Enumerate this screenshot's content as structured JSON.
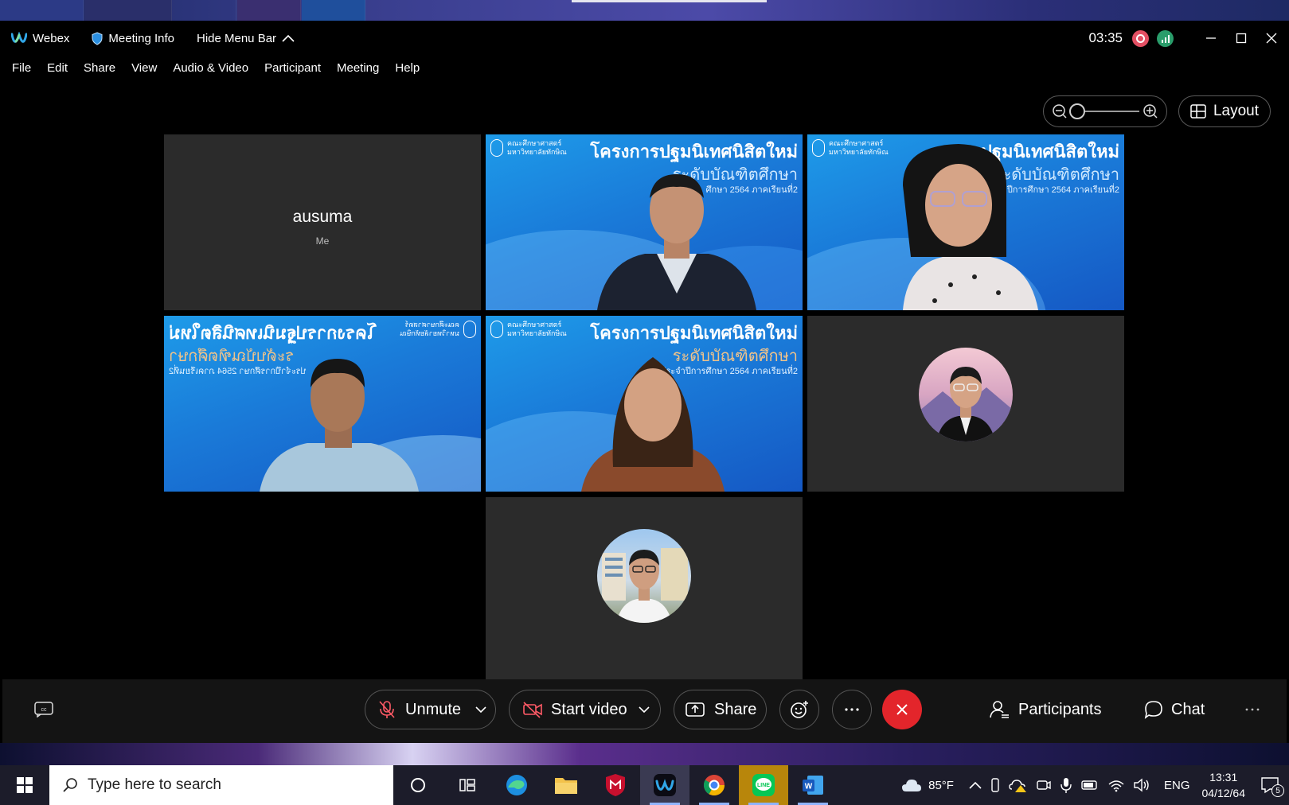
{
  "window": {
    "app_name": "Webex",
    "meeting_info_label": "Meeting Info",
    "hide_menu_label": "Hide Menu Bar",
    "elapsed_time": "03:35"
  },
  "menu": [
    "File",
    "Edit",
    "Share",
    "View",
    "Audio & Video",
    "Participant",
    "Meeting",
    "Help"
  ],
  "layout_label": "Layout",
  "tiles": {
    "self_name": "ausuma",
    "self_tag": "Me",
    "banner_title": "โครงการปฐมนิเทศนิสิตใหม่",
    "banner_sub": "ระดับบัณฑิตศึกษา",
    "banner_sub2": "ประจำปีการศึกษา 2564 ภาคเรียนที่2",
    "faculty": "คณะศึกษาศาสตร์",
    "university": "มหาวิทยาลัยทักษิณ",
    "tile3_title": "ปฐมนิเทศนิสิตใหม่",
    "tile3_sub": "ระดับบัณฑิตศึกษา",
    "tile3_sub2": "ระจำปีการศึกษา 2564 ภาคเรียนที่2",
    "tile1_sub2": "ศึกษา 2564 ภาคเรียนที่2"
  },
  "controls": {
    "unmute": "Unmute",
    "start_video": "Start video",
    "share": "Share",
    "participants": "Participants",
    "chat": "Chat"
  },
  "taskbar": {
    "search_placeholder": "Type here to search",
    "weather": "85°F",
    "language": "ENG",
    "time": "13:31",
    "date": "04/12/64",
    "notification_count": "5"
  },
  "colors": {
    "end_call": "#e3252b",
    "recording": "#e34f63",
    "network_ok": "#2a9d6b",
    "banner_blue": "#1a7ad8"
  }
}
